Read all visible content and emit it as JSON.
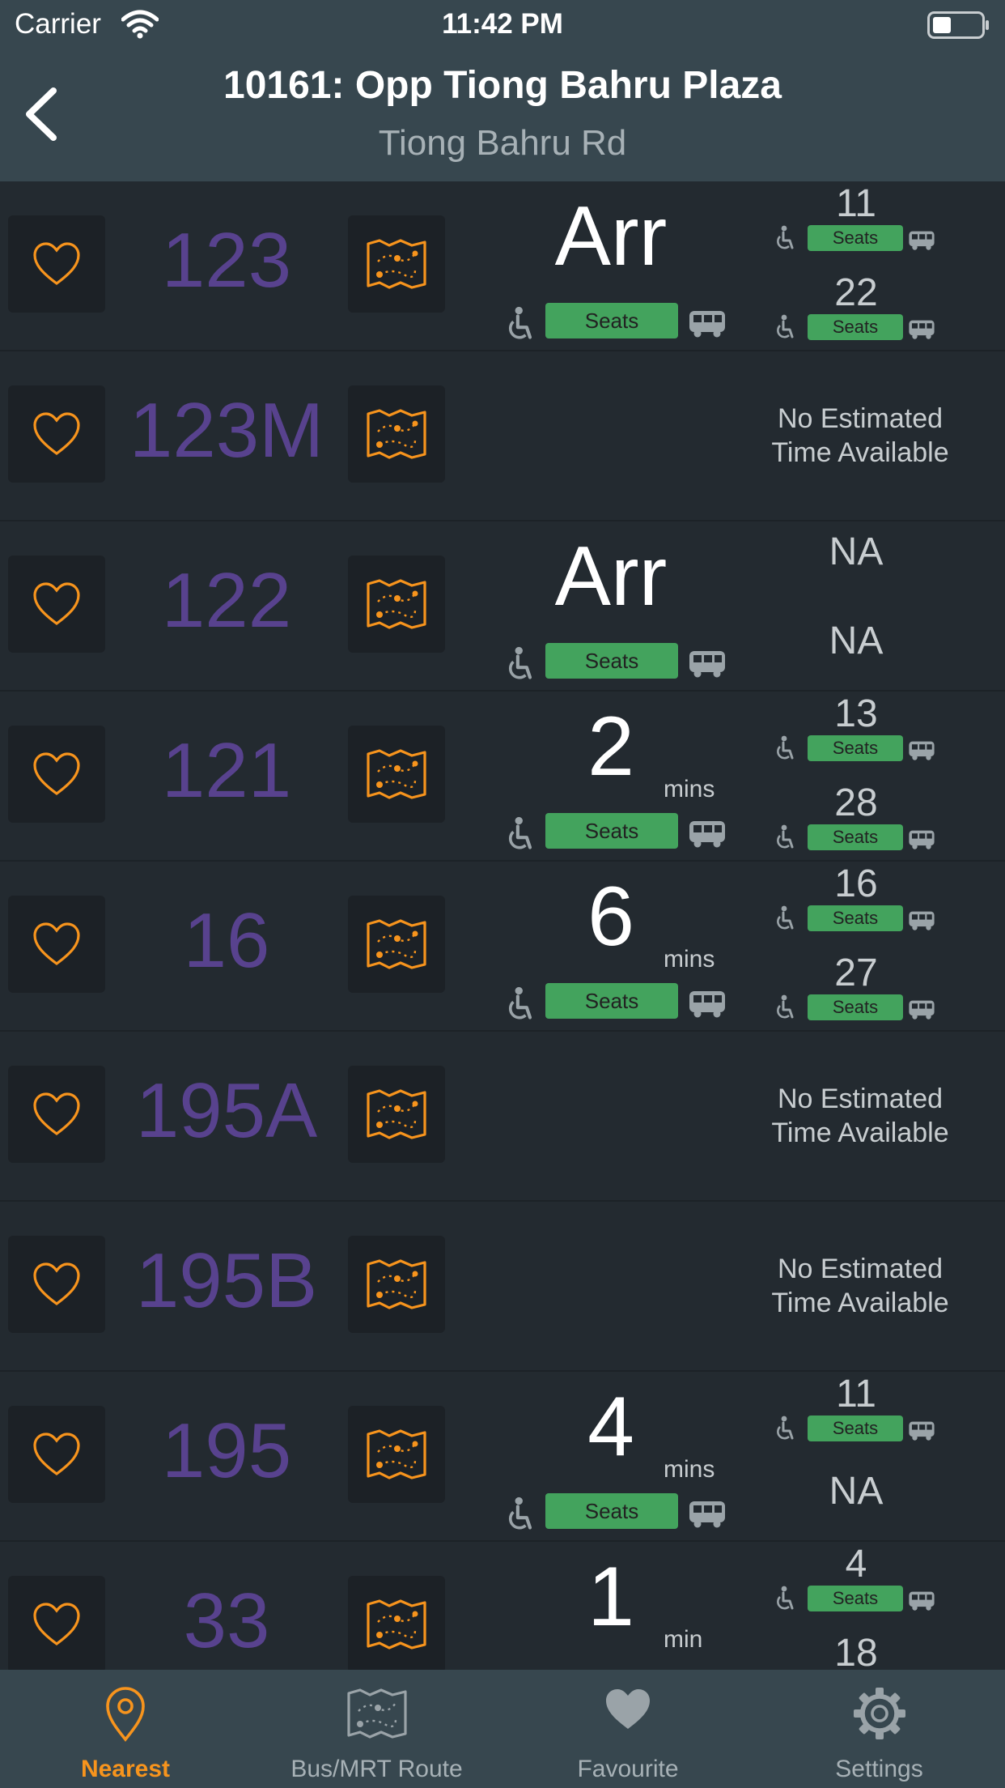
{
  "status_bar": {
    "carrier": "Carrier",
    "time": "11:42 PM"
  },
  "header": {
    "title": "10161: Opp Tiong Bahru Plaza",
    "subtitle": "Tiong Bahru Rd"
  },
  "colors": {
    "header_bg": "#37474f",
    "list_bg": "#232a30",
    "service_number": "#58428e",
    "accent": "#f7941d",
    "seats": "#43a35d"
  },
  "rows": [
    {
      "service": "123",
      "mode": "eta",
      "main": {
        "time": "Arr",
        "unit": "",
        "load": "Seats"
      },
      "next": [
        {
          "time": "11",
          "load": "Seats"
        },
        {
          "time": "22",
          "load": "Seats"
        }
      ]
    },
    {
      "service": "123M",
      "mode": "noeta",
      "noeta": [
        "No Estimated",
        "Time Available"
      ]
    },
    {
      "service": "122",
      "mode": "eta",
      "main": {
        "time": "Arr",
        "unit": "",
        "load": "Seats"
      },
      "next": [
        {
          "time": "NA"
        },
        {
          "time": "NA"
        }
      ]
    },
    {
      "service": "121",
      "mode": "eta",
      "main": {
        "time": "2",
        "unit": "mins",
        "load": "Seats"
      },
      "next": [
        {
          "time": "13",
          "load": "Seats"
        },
        {
          "time": "28",
          "load": "Seats"
        }
      ]
    },
    {
      "service": "16",
      "mode": "eta",
      "main": {
        "time": "6",
        "unit": "mins",
        "load": "Seats"
      },
      "next": [
        {
          "time": "16",
          "load": "Seats"
        },
        {
          "time": "27",
          "load": "Seats"
        }
      ]
    },
    {
      "service": "195A",
      "mode": "noeta",
      "noeta": [
        "No Estimated",
        "Time Available"
      ]
    },
    {
      "service": "195B",
      "mode": "noeta",
      "noeta": [
        "No Estimated",
        "Time Available"
      ]
    },
    {
      "service": "195",
      "mode": "eta",
      "main": {
        "time": "4",
        "unit": "mins",
        "load": "Seats"
      },
      "next": [
        {
          "time": "11",
          "load": "Seats"
        },
        {
          "time": "NA"
        }
      ]
    },
    {
      "service": "33",
      "mode": "eta",
      "main": {
        "time": "1",
        "unit": "min",
        "load": ""
      },
      "next": [
        {
          "time": "4",
          "load": "Seats"
        },
        {
          "time": "18"
        }
      ]
    }
  ],
  "tabs": [
    {
      "id": "nearest",
      "label": "Nearest",
      "icon": "location-pin-icon",
      "active": true
    },
    {
      "id": "route",
      "label": "Bus/MRT Route",
      "icon": "map-icon",
      "active": false
    },
    {
      "id": "favourite",
      "label": "Favourite",
      "icon": "heart-icon",
      "active": false
    },
    {
      "id": "settings",
      "label": "Settings",
      "icon": "gear-icon",
      "active": false
    }
  ]
}
